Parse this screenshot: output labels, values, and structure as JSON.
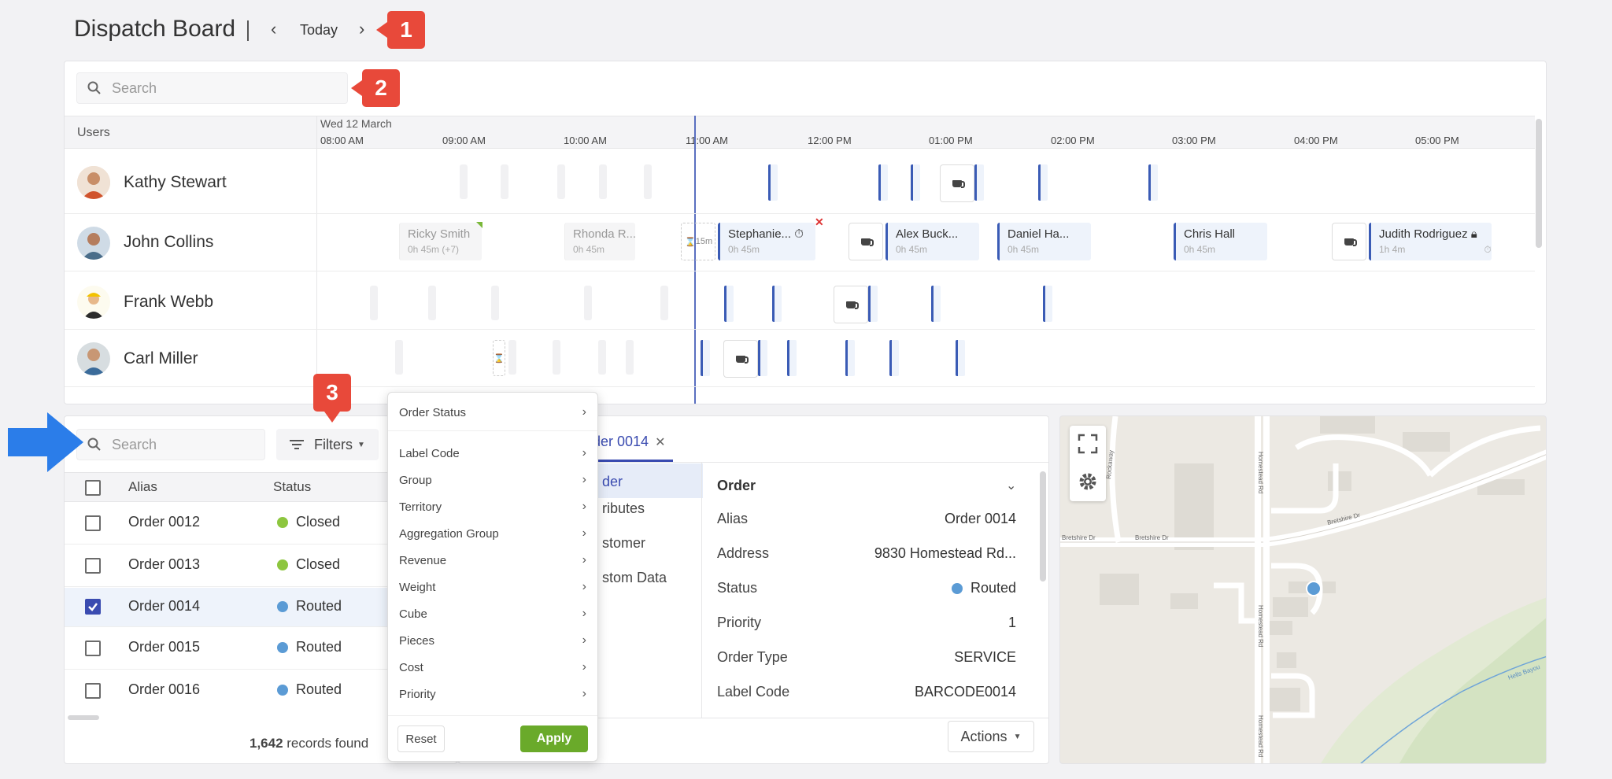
{
  "header": {
    "title": "Dispatch Board",
    "today_label": "Today"
  },
  "callouts": {
    "c1": "1",
    "c2": "2",
    "c3": "3"
  },
  "timeline": {
    "search_placeholder": "Search",
    "users_header": "Users",
    "date_label": "Wed 12 March",
    "hours": [
      "08:00 AM",
      "09:00 AM",
      "10:00 AM",
      "11:00 AM",
      "12:00 PM",
      "01:00 PM",
      "02:00 PM",
      "03:00 PM",
      "04:00 PM",
      "05:00 PM"
    ],
    "users": [
      {
        "name": "Kathy Stewart"
      },
      {
        "name": "John Collins"
      },
      {
        "name": "Frank Webb"
      },
      {
        "name": "Carl Miller"
      }
    ],
    "john_events": {
      "e1": {
        "title": "Ricky Smith",
        "dur": "0h 45m (+7)"
      },
      "e2": {
        "title": "Rhonda R...",
        "dur": "0h 45m"
      },
      "gap": "15m",
      "e3": {
        "title": "Stephanie...",
        "dur": "0h 45m"
      },
      "e4": {
        "title": "Alex Buck...",
        "dur": "0h 45m"
      },
      "e5": {
        "title": "Daniel Ha...",
        "dur": "0h 45m"
      },
      "e6": {
        "title": "Chris Hall",
        "dur": "0h 45m"
      },
      "e7": {
        "title": "Judith Rodriguez",
        "dur": "1h 4m"
      }
    }
  },
  "orders": {
    "search_placeholder": "Search",
    "filters_label": "Filters",
    "col_alias": "Alias",
    "col_status": "Status",
    "rows": [
      {
        "alias": "Order 0012",
        "status": "Closed"
      },
      {
        "alias": "Order 0013",
        "status": "Closed"
      },
      {
        "alias": "Order 0014",
        "status": "Routed"
      },
      {
        "alias": "Order 0015",
        "status": "Routed"
      },
      {
        "alias": "Order 0016",
        "status": "Routed"
      }
    ],
    "records_count": "1,642",
    "records_suffix": " records found",
    "status_colors": {
      "Closed": "#8dc63f",
      "Routed": "#5b9bd5"
    }
  },
  "filter_menu": {
    "items": [
      "Order Status",
      "Label Code",
      "Group",
      "Territory",
      "Aggregation Group",
      "Revenue",
      "Weight",
      "Cube",
      "Pieces",
      "Cost",
      "Priority"
    ],
    "reset_label": "Reset",
    "apply_label": "Apply"
  },
  "detail": {
    "tab_label": "der 0014",
    "nav": [
      "der",
      "ributes",
      "stomer",
      "stom Data"
    ],
    "section_title": "Order",
    "fields": [
      {
        "label": "Alias",
        "value": "Order 0014"
      },
      {
        "label": "Address",
        "value": "9830 Homestead Rd..."
      },
      {
        "label": "Status",
        "value": "Routed"
      },
      {
        "label": "Priority",
        "value": "1"
      },
      {
        "label": "Order Type",
        "value": "SERVICE"
      },
      {
        "label": "Label Code",
        "value": "BARCODE0014"
      }
    ],
    "actions_label": "Actions"
  },
  "map": {
    "streets": [
      "Bretshire Dr",
      "Bretshire Dr",
      "Bretshire Dr",
      "Homestead Rd",
      "Homestead Rd",
      "Homestead Rd",
      "Rockaway",
      "Hells Bayou"
    ]
  }
}
